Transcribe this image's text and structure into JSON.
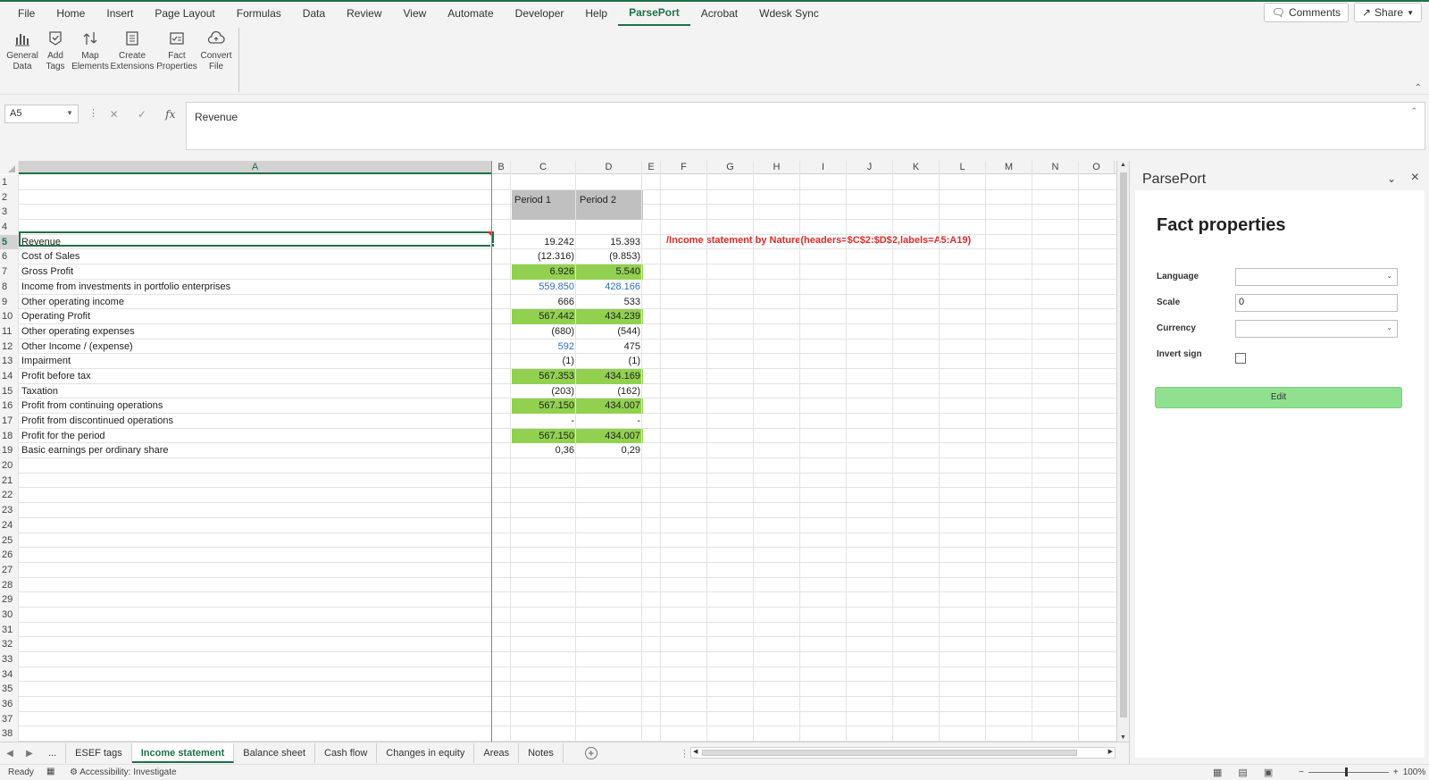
{
  "menu": {
    "items": [
      "File",
      "Home",
      "Insert",
      "Page Layout",
      "Formulas",
      "Data",
      "Review",
      "View",
      "Automate",
      "Developer",
      "Help",
      "ParsePort",
      "Acrobat",
      "Wdesk Sync"
    ],
    "active": "ParsePort",
    "comments_label": "Comments",
    "share_label": "Share"
  },
  "ribbon": {
    "buttons": [
      {
        "label1": "General",
        "label2": "Data",
        "icon": "bar-chart-icon"
      },
      {
        "label1": "Add",
        "label2": "Tags",
        "icon": "tag-check-icon"
      },
      {
        "label1": "Map",
        "label2": "Elements",
        "icon": "map-elements-icon"
      },
      {
        "label1": "Create",
        "label2": "Extensions",
        "icon": "document-list-icon"
      },
      {
        "label1": "Fact",
        "label2": "Properties",
        "icon": "fact-properties-icon"
      },
      {
        "label1": "Convert",
        "label2": "File",
        "icon": "cloud-convert-icon"
      }
    ]
  },
  "formula_bar": {
    "name_box": "A5",
    "formula": "Revenue"
  },
  "sheet": {
    "columns": [
      "A",
      "B",
      "C",
      "D",
      "E",
      "F",
      "G",
      "H",
      "I",
      "J",
      "K",
      "L",
      "M",
      "N",
      "O"
    ],
    "header_c": "Period 1",
    "header_d": "Period 2",
    "annotation": "/Income statement by Nature(headers=$C$2:$D$2,labels=A5:A19)",
    "rows": [
      {
        "n": "1",
        "label": "",
        "c": "",
        "d": ""
      },
      {
        "n": "2",
        "label": "",
        "c": "",
        "d": ""
      },
      {
        "n": "3",
        "label": "",
        "c": "",
        "d": ""
      },
      {
        "n": "4",
        "label": "",
        "c": "",
        "d": ""
      },
      {
        "n": "5",
        "label": "Revenue",
        "c": "19.242",
        "d": "15.393"
      },
      {
        "n": "6",
        "label": "Cost of Sales",
        "c": "(12.316)",
        "d": "(9.853)"
      },
      {
        "n": "7",
        "label": "Gross Profit",
        "c": "6.926",
        "d": "5.540",
        "style": "green"
      },
      {
        "n": "8",
        "label": "Income from investments in portfolio enterprises",
        "c": "559.850",
        "d": "428.166",
        "style": "blue"
      },
      {
        "n": "9",
        "label": "Other operating income",
        "c": "666",
        "d": "533"
      },
      {
        "n": "10",
        "label": "Operating Profit",
        "c": "567.442",
        "d": "434.239",
        "style": "green"
      },
      {
        "n": "11",
        "label": "Other operating expenses",
        "c": "(680)",
        "d": "(544)"
      },
      {
        "n": "12",
        "label": "Other Income / (expense)",
        "c": "592",
        "d": "475",
        "style": "blue-c"
      },
      {
        "n": "13",
        "label": "Impairment",
        "c": "(1)",
        "d": "(1)"
      },
      {
        "n": "14",
        "label": "Profit before tax",
        "c": "567.353",
        "d": "434.169",
        "style": "green"
      },
      {
        "n": "15",
        "label": "Taxation",
        "c": "(203)",
        "d": "(162)"
      },
      {
        "n": "16",
        "label": "Profit from continuing operations",
        "c": "567.150",
        "d": "434.007",
        "style": "green"
      },
      {
        "n": "17",
        "label": "Profit from discontinued operations",
        "c": "-",
        "d": "-"
      },
      {
        "n": "18",
        "label": "Profit for the period",
        "c": "567.150",
        "d": "434.007",
        "style": "green"
      },
      {
        "n": "19",
        "label": "Basic earnings per ordinary share",
        "c": "0,36",
        "d": "0,29"
      },
      {
        "n": "20",
        "label": "",
        "c": "",
        "d": ""
      },
      {
        "n": "21",
        "label": "",
        "c": "",
        "d": ""
      },
      {
        "n": "22",
        "label": "",
        "c": "",
        "d": ""
      },
      {
        "n": "23",
        "label": "",
        "c": "",
        "d": ""
      },
      {
        "n": "24",
        "label": "",
        "c": "",
        "d": ""
      },
      {
        "n": "25",
        "label": "",
        "c": "",
        "d": ""
      },
      {
        "n": "26",
        "label": "",
        "c": "",
        "d": ""
      },
      {
        "n": "27",
        "label": "",
        "c": "",
        "d": ""
      },
      {
        "n": "28",
        "label": "",
        "c": "",
        "d": ""
      },
      {
        "n": "29",
        "label": "",
        "c": "",
        "d": ""
      },
      {
        "n": "30",
        "label": "",
        "c": "",
        "d": ""
      },
      {
        "n": "31",
        "label": "",
        "c": "",
        "d": ""
      },
      {
        "n": "32",
        "label": "",
        "c": "",
        "d": ""
      },
      {
        "n": "33",
        "label": "",
        "c": "",
        "d": ""
      },
      {
        "n": "34",
        "label": "",
        "c": "",
        "d": ""
      },
      {
        "n": "35",
        "label": "",
        "c": "",
        "d": ""
      },
      {
        "n": "36",
        "label": "",
        "c": "",
        "d": ""
      },
      {
        "n": "37",
        "label": "",
        "c": "",
        "d": ""
      },
      {
        "n": "38",
        "label": "",
        "c": "",
        "d": ""
      }
    ]
  },
  "tabs": {
    "items": [
      "ESEF tags",
      "Income statement",
      "Balance sheet",
      "Cash flow",
      "Changes in equity",
      "Areas",
      "Notes"
    ],
    "active": "Income statement",
    "more_label": "..."
  },
  "status": {
    "ready": "Ready",
    "accessibility": "Accessibility: Investigate",
    "zoom": "100%"
  },
  "pane": {
    "title": "ParsePort",
    "heading": "Fact properties",
    "language_label": "Language",
    "language_value": "",
    "scale_label": "Scale",
    "scale_value": "0",
    "currency_label": "Currency",
    "currency_value": "",
    "invert_label": "Invert sign",
    "invert_checked": false,
    "edit_label": "Edit"
  },
  "colors": {
    "accent": "#1e7145",
    "highlight_green": "#92d050",
    "edit_button": "#8fe08f",
    "annotation_red": "#e82727",
    "blue_text": "#2f6fbd"
  }
}
